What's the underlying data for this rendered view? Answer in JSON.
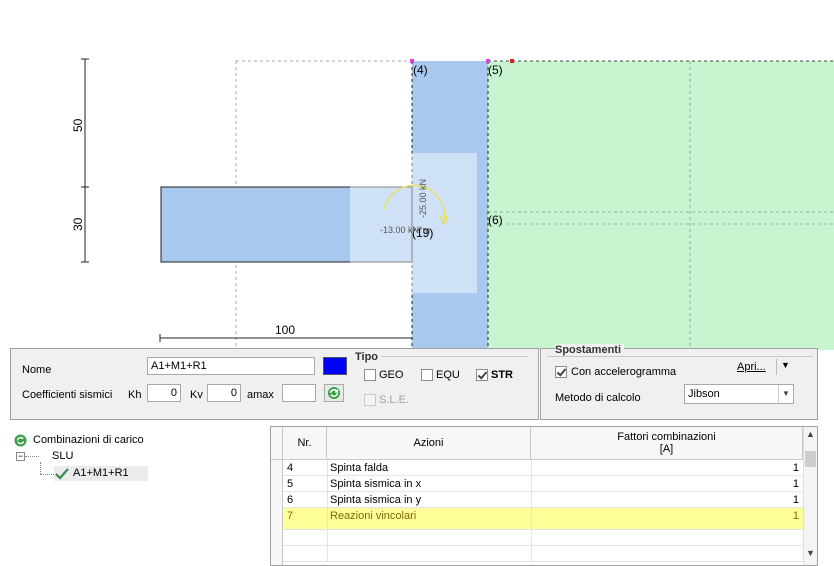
{
  "drawing": {
    "dim_50": "50",
    "dim_30": "30",
    "dim_100": "100",
    "node_4": "(4)",
    "node_5": "(5)",
    "node_6": "(6)",
    "node_19": "(19)",
    "force_vertical": "-25.00 kN",
    "force_moment": "-13.00 kN*m"
  },
  "props": {
    "nome_label": "Nome",
    "nome_value": "A1+M1+R1",
    "color": "#0000ff",
    "coeff_label": "Coefficienti sismici",
    "kh_label": "Kh",
    "kh_value": "0",
    "kv_label": "Kv",
    "kv_value": "0",
    "amax_label": "amax",
    "amax_value": "",
    "tipo_title": "Tipo",
    "geo_label": "GEO",
    "equ_label": "EQU",
    "str_label": "STR",
    "sle_label": "S.L.E.",
    "geo_checked": false,
    "equ_checked": false,
    "str_checked": true
  },
  "spostamenti": {
    "title": "Spostamenti",
    "accel_label": "Con accelerogramma",
    "accel_checked": true,
    "apri_label": "Apri...",
    "metodo_label": "Metodo di calcolo",
    "metodo_value": "Jibson"
  },
  "tree": {
    "root_label": "Combinazioni di carico",
    "slu_label": "SLU",
    "item_label": "A1+M1+R1"
  },
  "grid": {
    "col_nr": "Nr.",
    "col_azioni": "Azioni",
    "col_fattori_1": "Fattori combinazioni",
    "col_fattori_2": "[A]",
    "rows": [
      {
        "nr": "4",
        "azione": "Spinta falda",
        "fattore": "1"
      },
      {
        "nr": "5",
        "azione": "Spinta sismica in x",
        "fattore": "1"
      },
      {
        "nr": "6",
        "azione": "Spinta sismica in y",
        "fattore": "1"
      },
      {
        "nr": "7",
        "azione": "Reazioni vincolari",
        "fattore": "1"
      }
    ]
  },
  "colors": {
    "wall": "#a8c8ee",
    "soil": "#c8f5d0",
    "highlight": "#ffff99"
  }
}
